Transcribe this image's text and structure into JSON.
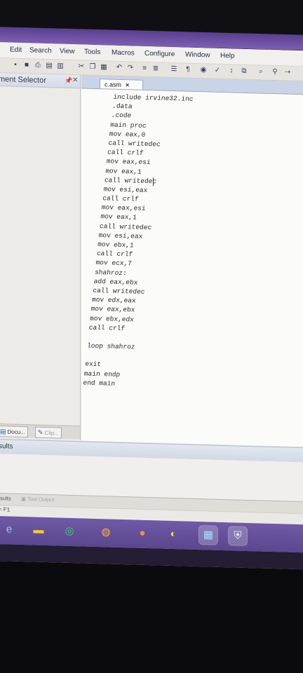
{
  "menu": [
    "Edit",
    "Search",
    "View",
    "Tools",
    "Macros",
    "Configure",
    "Window",
    "Help"
  ],
  "toolbar_icons": [
    "save-icon",
    "floppy-icon",
    "print-icon",
    "preview-icon",
    "cut-icon",
    "copy-icon",
    "paste-icon",
    "undo-icon",
    "redo-icon",
    "indent-icon",
    "outdent-icon",
    "paragraph-icon",
    "stop-icon",
    "spell-icon",
    "sort-icon",
    "find-icon",
    "replace-icon"
  ],
  "left_panel": {
    "title": "ment Selector",
    "tabs": [
      "Docu...",
      "Clip..."
    ]
  },
  "editor": {
    "tab_label": "c.asm",
    "tab_close": "×",
    "code_lines": [
      "include irvine32.inc",
      ".data",
      ".code",
      "main proc",
      "mov eax,0",
      "call writedec",
      "call crlf",
      "mov eax,esi",
      "mov eax,1",
      "call writedec",
      "mov esi,eax",
      "call crlf",
      "mov eax,esi",
      "mov eax,1",
      "call writedec",
      "mov esi,eax",
      "mov ebx,1",
      "call crlf",
      "mov ecx,7",
      "shahroz:",
      "add eax,ebx",
      "call writedec",
      "mov edx,eax",
      "mov eax,ebx",
      "mov ebx,edx",
      "call crlf",
      "",
      "loop shahroz",
      "",
      "exit",
      "main endp",
      "end main"
    ]
  },
  "results": {
    "title": "sults",
    "tabs": [
      "esults",
      "Tool Output"
    ]
  },
  "status": {
    "text": "= F1"
  },
  "taskbar": [
    "ie-icon",
    "folder-icon",
    "whatsapp-icon",
    "firefox-icon",
    "browser-icon",
    "chrome-icon",
    "app-icon",
    "shield-icon"
  ],
  "colors": {
    "taskbar": "#6f5aa6",
    "editor_bg": "#fbfbfa",
    "panel_header": "#d4dbe8"
  }
}
